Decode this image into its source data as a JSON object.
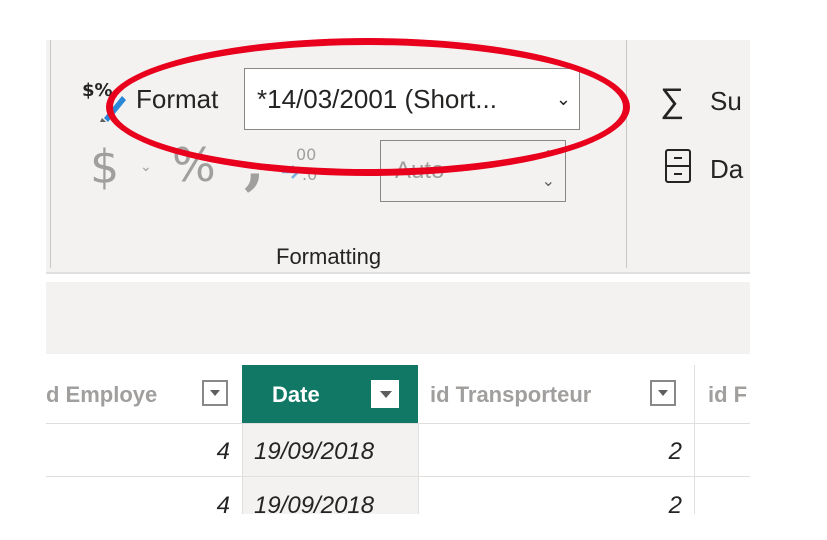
{
  "ribbon": {
    "format_label": "Format",
    "format_value": "*14/03/2001 (Short...",
    "auto_value": "Auto",
    "group_label": "Formatting",
    "sum_label": "Su",
    "data_label": "Da"
  },
  "table": {
    "columns": [
      {
        "label": "d Employe"
      },
      {
        "label": "Date"
      },
      {
        "label": "id Transporteur"
      },
      {
        "label": "id F"
      }
    ],
    "rows": [
      {
        "employe": "4",
        "date": "19/09/2018",
        "transporteur": "2"
      },
      {
        "employe": "4",
        "date": "19/09/2018",
        "transporteur": "2"
      }
    ]
  },
  "colors": {
    "accent": "#117865",
    "annotation": "#e8001c"
  }
}
